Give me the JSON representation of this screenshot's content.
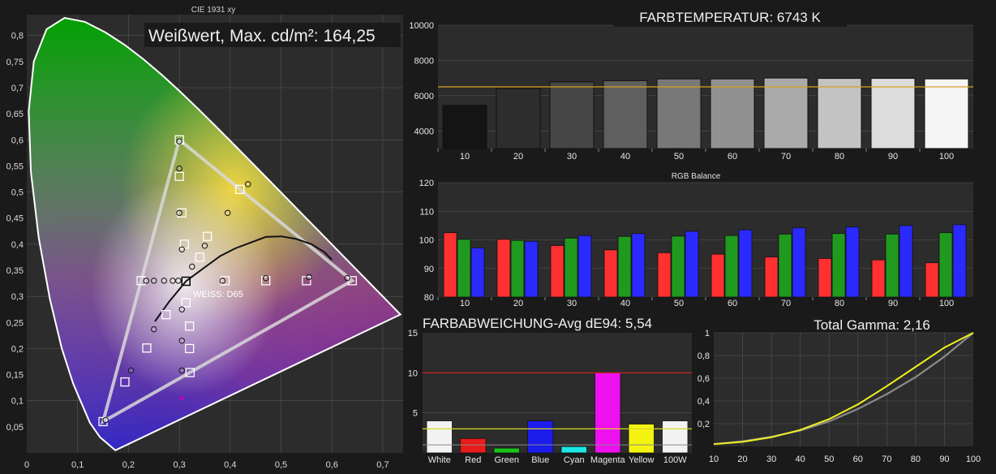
{
  "cie": {
    "title": "CIE 1931 xy",
    "headline": "Weißwert, Max. cd/m²: 164,25",
    "white_label": "WEISS: D65",
    "x_ticks": [
      "0",
      "0,1",
      "0,2",
      "0,3",
      "0,4",
      "0,5",
      "0,6",
      "0,7"
    ],
    "y_ticks": [
      "0,05",
      "0,1",
      "0,15",
      "0,2",
      "0,25",
      "0,3",
      "0,35",
      "0,4",
      "0,45",
      "0,5",
      "0,55",
      "0,6",
      "0,65",
      "0,7",
      "0,75",
      "0,8"
    ]
  },
  "chart_data": [
    {
      "type": "scatter",
      "title": "CIE 1931 xy",
      "xlim": [
        0,
        0.74
      ],
      "ylim": [
        0,
        0.84
      ],
      "target_gamut": [
        [
          0.64,
          0.33
        ],
        [
          0.3,
          0.6
        ],
        [
          0.15,
          0.06
        ]
      ],
      "targets": [
        [
          0.64,
          0.33
        ],
        [
          0.3,
          0.6
        ],
        [
          0.15,
          0.06
        ],
        [
          0.225,
          0.33
        ],
        [
          0.313,
          0.329
        ],
        [
          0.419,
          0.505
        ],
        [
          0.321,
          0.154
        ],
        [
          0.55,
          0.33
        ],
        [
          0.47,
          0.33
        ],
        [
          0.39,
          0.33
        ],
        [
          0.3,
          0.53
        ],
        [
          0.305,
          0.46
        ],
        [
          0.31,
          0.4
        ],
        [
          0.355,
          0.415
        ],
        [
          0.34,
          0.375
        ],
        [
          0.274,
          0.265
        ],
        [
          0.193,
          0.136
        ],
        [
          0.236,
          0.201
        ],
        [
          0.313,
          0.288
        ],
        [
          0.32,
          0.243
        ],
        [
          0.32,
          0.2
        ]
      ],
      "measured": [
        [
          0.63,
          0.335
        ],
        [
          0.3,
          0.597
        ],
        [
          0.155,
          0.063
        ],
        [
          0.235,
          0.33
        ],
        [
          0.25,
          0.33
        ],
        [
          0.27,
          0.33
        ],
        [
          0.287,
          0.33
        ],
        [
          0.298,
          0.33
        ],
        [
          0.435,
          0.515
        ],
        [
          0.395,
          0.46
        ],
        [
          0.35,
          0.397
        ],
        [
          0.325,
          0.357
        ],
        [
          0.3,
          0.545
        ],
        [
          0.3,
          0.46
        ],
        [
          0.305,
          0.39
        ],
        [
          0.385,
          0.33
        ],
        [
          0.47,
          0.335
        ],
        [
          0.555,
          0.337
        ],
        [
          0.305,
          0.275
        ],
        [
          0.305,
          0.215
        ],
        [
          0.305,
          0.158
        ],
        [
          0.205,
          0.158
        ],
        [
          0.25,
          0.237
        ]
      ],
      "measured_magenta": [
        [
          0.305,
          0.105
        ]
      ],
      "white_point": [
        0.313,
        0.329
      ]
    },
    {
      "type": "bar",
      "title": "FARBTEMPERATUR: 6743 K",
      "categories": [
        "10",
        "20",
        "30",
        "40",
        "50",
        "60",
        "70",
        "80",
        "90",
        "100"
      ],
      "values": [
        5450,
        6400,
        6780,
        6850,
        6950,
        6950,
        7000,
        6980,
        6980,
        6950
      ],
      "ylim": [
        3000,
        10000
      ],
      "y_ticks": [
        "4000",
        "6000",
        "8000",
        "10000"
      ],
      "reference_line": 6500
    },
    {
      "type": "bar",
      "title": "RGB Balance",
      "categories": [
        "10",
        "20",
        "30",
        "40",
        "50",
        "60",
        "70",
        "80",
        "90",
        "100"
      ],
      "series": [
        {
          "values": [
            102.5,
            100.2,
            98.0,
            96.5,
            95.5,
            95.0,
            94.0,
            93.5,
            93.0,
            92.0
          ]
        },
        {
          "values": [
            100.2,
            99.8,
            100.6,
            101.2,
            101.3,
            101.5,
            102.0,
            102.2,
            102.0,
            102.5
          ]
        },
        {
          "values": [
            97.2,
            99.5,
            101.5,
            102.2,
            103.0,
            103.5,
            104.2,
            104.5,
            105.0,
            105.3
          ]
        }
      ],
      "ylim": [
        80,
        120
      ],
      "y_ticks": [
        "80",
        "90",
        "100",
        "110",
        "120"
      ]
    },
    {
      "type": "bar",
      "title": "FARBABWEICHUNG-Avg dE94: 5,54",
      "categories": [
        "White",
        "Red",
        "Green",
        "Blue",
        "Cyan",
        "Magenta",
        "Yellow",
        "100W"
      ],
      "values": [
        4.0,
        1.8,
        0.6,
        4.0,
        0.8,
        10.0,
        3.6,
        4.0
      ],
      "colors": [
        "#f2f2f2",
        "#e81c1c",
        "#1ac41a",
        "#1c1cec",
        "#1ce6e6",
        "#ee10ee",
        "#f4f410",
        "#f2f2f2"
      ],
      "ylim": [
        0,
        15
      ],
      "y_ticks": [
        "5",
        "10",
        "15"
      ],
      "threshold_lines": [
        3,
        10
      ]
    },
    {
      "type": "line",
      "title": "Total Gamma: 2,16",
      "x_ticks": [
        "10",
        "20",
        "30",
        "40",
        "50",
        "60",
        "70",
        "80",
        "90",
        "100"
      ],
      "y_ticks": [
        "0,2",
        "0,4",
        "0,6",
        "0,8",
        "1"
      ],
      "xlim": [
        10,
        100
      ],
      "ylim": [
        0,
        1
      ],
      "series": [
        {
          "x": [
            10,
            20,
            30,
            40,
            50,
            60,
            70,
            80,
            90,
            100
          ],
          "y": [
            0.02,
            0.045,
            0.085,
            0.14,
            0.22,
            0.33,
            0.46,
            0.61,
            0.79,
            1.0
          ]
        },
        {
          "x": [
            10,
            20,
            30,
            40,
            50,
            60,
            70,
            80,
            90,
            100
          ],
          "y": [
            0.02,
            0.04,
            0.08,
            0.145,
            0.24,
            0.37,
            0.53,
            0.7,
            0.87,
            1.0
          ]
        }
      ]
    }
  ],
  "colors": {
    "background": "#1a1a1a",
    "panel": "#2c2c2c",
    "grid": "#5a5a5a",
    "axis_text": "#e6e6e6",
    "ct_ref_line": "#d8a020",
    "red_line": "#e02020",
    "yellow_line": "#d8d820"
  }
}
